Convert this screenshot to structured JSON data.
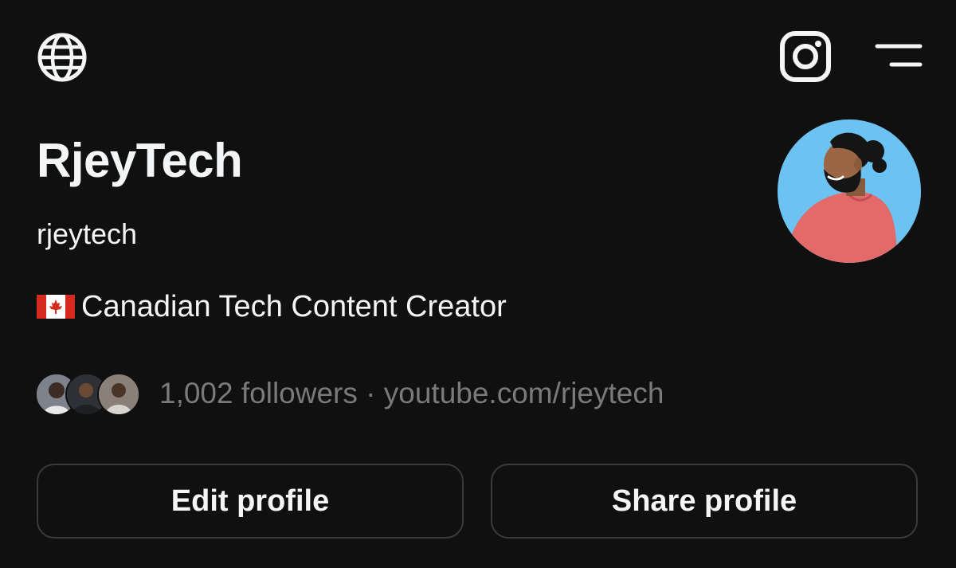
{
  "header": {
    "left_icon": "globe-icon",
    "right_icons": [
      "instagram-icon",
      "menu-icon"
    ]
  },
  "profile": {
    "display_name": "RjeyTech",
    "username": "rjeytech",
    "bio_flag": "canada-flag-icon",
    "bio_text": "Canadian Tech Content Creator",
    "avatar": "profile-avatar"
  },
  "stats": {
    "followers": "1,002 followers",
    "separator": " · ",
    "link": "youtube.com/rjeytech"
  },
  "actions": {
    "edit_label": "Edit profile",
    "share_label": "Share profile"
  },
  "colors": {
    "background": "#101010",
    "text_primary": "#f3f5f7",
    "text_secondary": "#7a7a7a",
    "button_border": "#3a3a3a",
    "avatar_bg": "#6cc3f2",
    "sweater": "#e46a6a"
  }
}
